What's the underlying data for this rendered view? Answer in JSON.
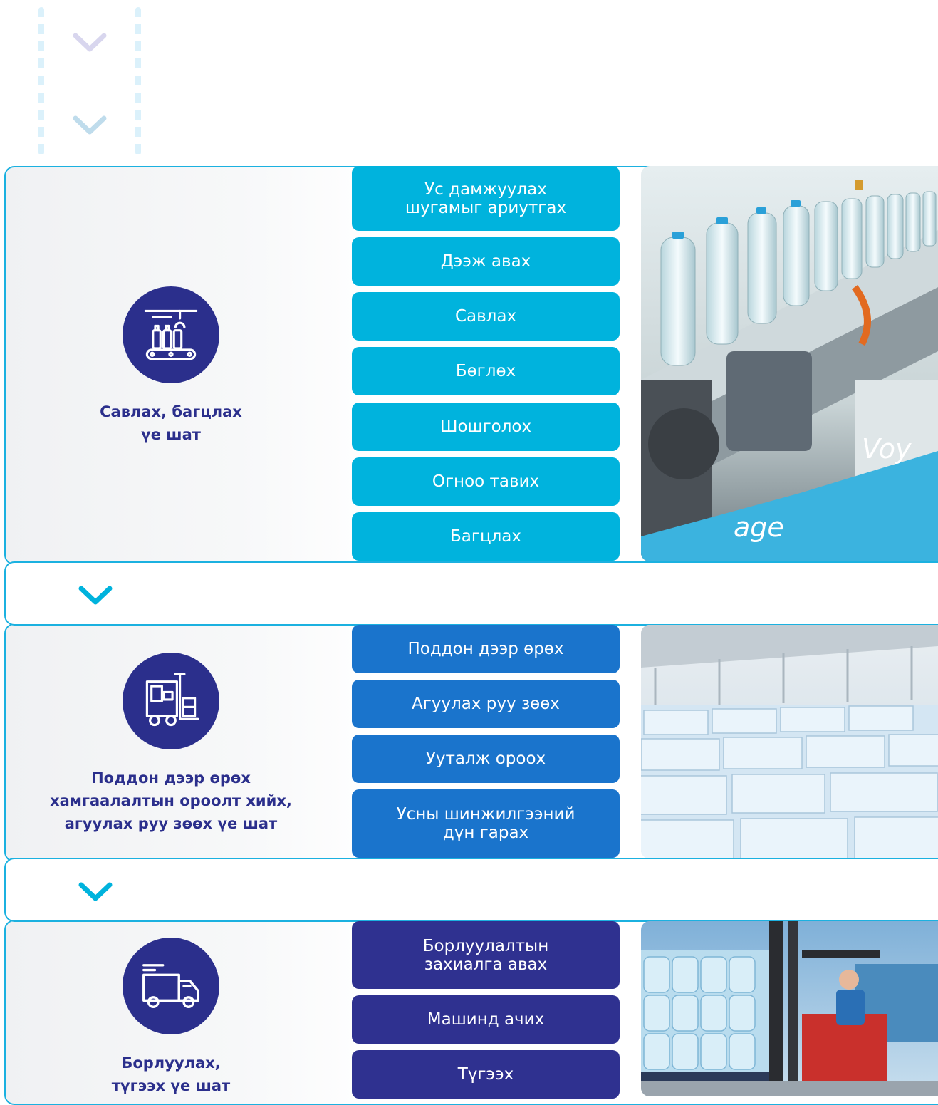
{
  "stages": [
    {
      "label": "Савлах, багцлах\nүе шат",
      "icon": "bottling-conveyor-icon",
      "color": "#00b3dd",
      "steps": [
        "Ус дамжуулах\nшугамыг ариутгах",
        "Дээж авах",
        "Савлах",
        "Бөглөх",
        "Шошголох",
        "Огноо тавих",
        "Багцлах"
      ],
      "photo": "bottling-line-photo"
    },
    {
      "label": "Поддон дээр өрөх\nхамгаалалтын ороолт хийх,\nагуулах руу зөөх үе шат",
      "icon": "forklift-icon",
      "color": "#1a74cc",
      "steps": [
        "Поддон дээр өрөх",
        "Агуулах руу зөөх",
        "Ууталж ороох",
        "Усны шинжилгээний\nдүн гарах"
      ],
      "photo": "warehouse-photo"
    },
    {
      "label": "Борлуулах,\nтүгээх үе шат",
      "icon": "delivery-truck-icon",
      "color": "#2f3190",
      "steps": [
        "Борлуулалтын\nзахиалга авах",
        "Машинд ачих",
        "Түгээх"
      ],
      "photo": "forklift-loading-photo"
    }
  ],
  "colors": {
    "accent": "#1bb1e0",
    "navy": "#2b2f8c"
  }
}
